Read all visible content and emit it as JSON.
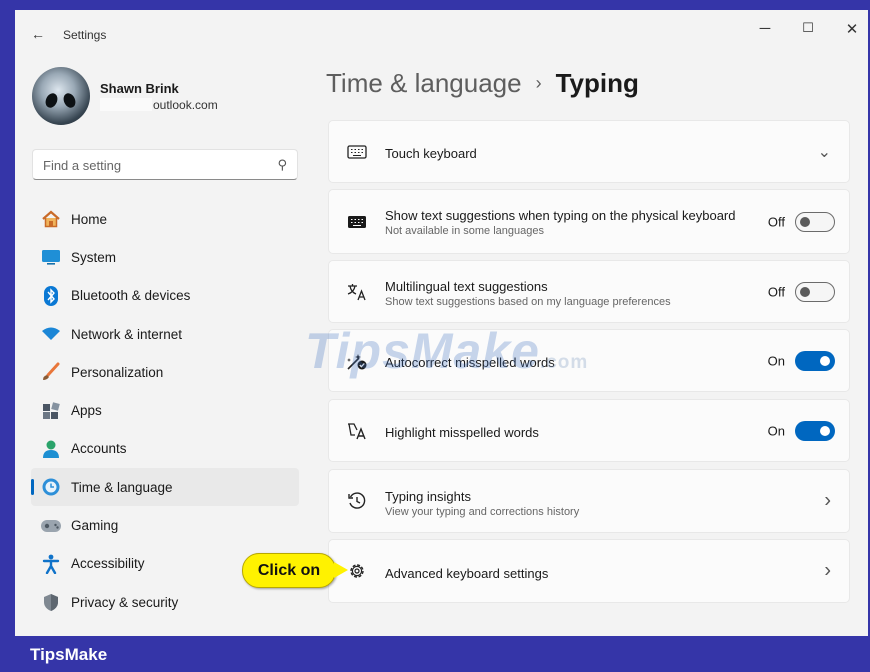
{
  "window": {
    "title": "Settings",
    "back_glyph": "←",
    "minimize_glyph": "─",
    "maximize_glyph": "☐",
    "close_glyph": "✕"
  },
  "user": {
    "name": "Shawn Brink",
    "email": "outlook.com"
  },
  "search": {
    "placeholder": "Find a setting",
    "icon": "search-icon",
    "icon_glyph": "⚲"
  },
  "nav": {
    "items": [
      {
        "label": "Home",
        "icon": "home-icon"
      },
      {
        "label": "System",
        "icon": "system-icon"
      },
      {
        "label": "Bluetooth & devices",
        "icon": "bluetooth-icon"
      },
      {
        "label": "Network & internet",
        "icon": "network-icon"
      },
      {
        "label": "Personalization",
        "icon": "brush-icon"
      },
      {
        "label": "Apps",
        "icon": "apps-icon"
      },
      {
        "label": "Accounts",
        "icon": "accounts-icon"
      },
      {
        "label": "Time & language",
        "icon": "time-language-icon",
        "active": true
      },
      {
        "label": "Gaming",
        "icon": "gaming-icon"
      },
      {
        "label": "Accessibility",
        "icon": "accessibility-icon"
      },
      {
        "label": "Privacy & security",
        "icon": "shield-icon"
      }
    ]
  },
  "breadcrumb": {
    "parent": "Time & language",
    "separator": "›",
    "current": "Typing"
  },
  "settings": [
    {
      "title": "Touch keyboard",
      "icon": "touch-keyboard-icon",
      "control": "expand",
      "control_glyph": "⌄"
    },
    {
      "title": "Show text suggestions when typing on the physical keyboard",
      "subtitle": "Not available in some languages",
      "icon": "keyboard-icon",
      "state": "Off",
      "control": "toggle"
    },
    {
      "title": "Multilingual text suggestions",
      "subtitle": "Show text suggestions based on my language preferences",
      "icon": "multilingual-icon",
      "state": "Off",
      "control": "toggle"
    },
    {
      "title": "Autocorrect misspelled words",
      "icon": "autocorrect-icon",
      "state": "On",
      "control": "toggle"
    },
    {
      "title": "Highlight misspelled words",
      "icon": "highlight-spelling-icon",
      "state": "On",
      "control": "toggle"
    },
    {
      "title": "Typing insights",
      "subtitle": "View your typing and corrections history",
      "icon": "history-icon",
      "control": "link",
      "control_glyph": "›"
    },
    {
      "title": "Advanced keyboard settings",
      "icon": "gear-icon",
      "control": "link",
      "control_glyph": "›"
    }
  ],
  "callout": {
    "text": "Click on"
  },
  "watermark": {
    "text": "TipsMake",
    "suffix": ".com"
  },
  "footer": {
    "brand": "TipsMake"
  },
  "colors": {
    "accent": "#0067c0",
    "frame": "#3535a8",
    "callout": "#fff200"
  }
}
